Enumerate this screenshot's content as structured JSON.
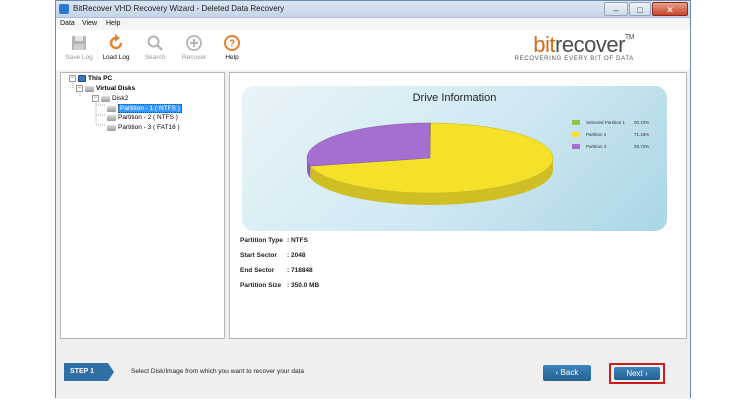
{
  "window": {
    "title": "BitRecover VHD Recovery Wizard - Deleted Data Recovery",
    "min_glyph": "–",
    "max_glyph": "□",
    "close_glyph": "✕"
  },
  "menu": [
    "Data",
    "View",
    "Help"
  ],
  "toolbar": {
    "save_log": "Save Log",
    "load_log": "Load Log",
    "search": "Search",
    "recover": "Recover",
    "help": "Help"
  },
  "brand": {
    "bit": "bit",
    "recover": "recover",
    "tm": "TM",
    "tagline": "RECOVERING EVERY BIT OF DATA"
  },
  "tree": {
    "root": "This PC",
    "virtual_disks": "Virtual Disks",
    "disk": "Disk2",
    "partitions": [
      "Partition - 1 ( NTFS )",
      "Partition - 2 ( NTFS )",
      "Partition - 3 ( FAT16 )"
    ],
    "expanded_glyph": "−"
  },
  "drive_info": {
    "title": "Drive Information",
    "legend": [
      {
        "name": "Selected Partition 1",
        "value": "00.10%",
        "color": "#8dc63f"
      },
      {
        "name": "Partition 2",
        "value": "71.18%",
        "color": "#f5e12a"
      },
      {
        "name": "Partition 3",
        "value": "28.72%",
        "color": "#a46fd1"
      }
    ]
  },
  "chart_data": {
    "type": "pie",
    "title": "Drive Information",
    "categories": [
      "Selected Partition 1",
      "Partition 2",
      "Partition 3"
    ],
    "values": [
      0.1,
      71.18,
      28.72
    ],
    "legend_position": "right"
  },
  "properties": [
    {
      "label": "Partition Type",
      "value": ": NTFS"
    },
    {
      "label": "Start Sector",
      "value": ": 2048"
    },
    {
      "label": "End Sector",
      "value": ": 718848"
    },
    {
      "label": "Partition Size",
      "value": ": 350.0 MB"
    }
  ],
  "footer": {
    "step": "STEP 1",
    "instruction": "Select Disk/Image from which you want to recover your data",
    "back": "‹ Back",
    "next": "Next ›"
  }
}
